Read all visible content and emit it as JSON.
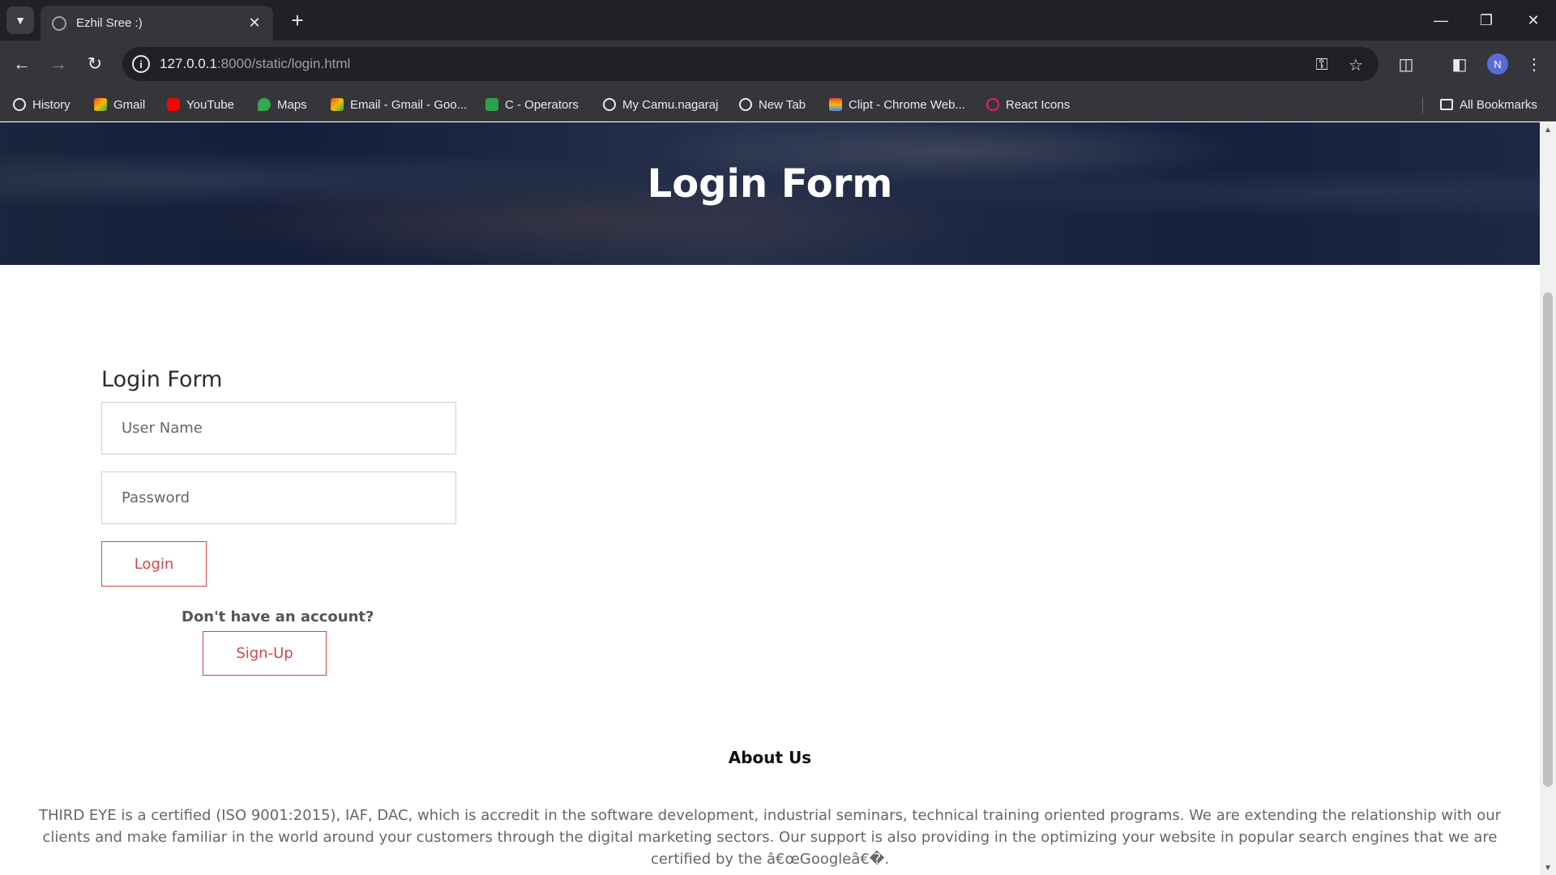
{
  "browser": {
    "tab_title": "Ezhil Sree :)",
    "url_host": "127.0.0.1",
    "url_rest": ":8000/static/login.html",
    "profile_initial": "N",
    "bookmarks": [
      {
        "label": "History",
        "icon": "history-icon"
      },
      {
        "label": "Gmail",
        "icon": "gmail-icon"
      },
      {
        "label": "YouTube",
        "icon": "youtube-icon"
      },
      {
        "label": "Maps",
        "icon": "maps-icon"
      },
      {
        "label": "Email - Gmail - Goo...",
        "icon": "gmail-icon"
      },
      {
        "label": "C - Operators",
        "icon": "page-icon"
      },
      {
        "label": "My Camu.nagaraj",
        "icon": "globe-icon"
      },
      {
        "label": "New Tab",
        "icon": "globe-icon"
      },
      {
        "label": "Clipt - Chrome Web...",
        "icon": "webstore-icon"
      },
      {
        "label": "React Icons",
        "icon": "react-icon"
      }
    ],
    "all_bookmarks": "All Bookmarks"
  },
  "page": {
    "hero_title": "Login Form",
    "form": {
      "heading": "Login Form",
      "username_placeholder": "User Name",
      "password_placeholder": "Password",
      "login_label": "Login",
      "no_account_text": "Don't have an account?",
      "signup_label": "Sign-Up"
    },
    "about": {
      "title": "About Us",
      "text": "THIRD EYE is a certified (ISO 9001:2015), IAF, DAC, which is accredit in the software development, industrial seminars, technical training oriented programs. We are extending the relationship with our clients and make familiar in the world around your customers through the digital marketing sectors. Our support is also providing in the optimizing your website in popular search engines that we are certified by the â€œGoogleâ€�."
    }
  },
  "colors": {
    "accent": "#d04848",
    "chrome_dark": "#202124",
    "chrome_mid": "#35363a"
  }
}
